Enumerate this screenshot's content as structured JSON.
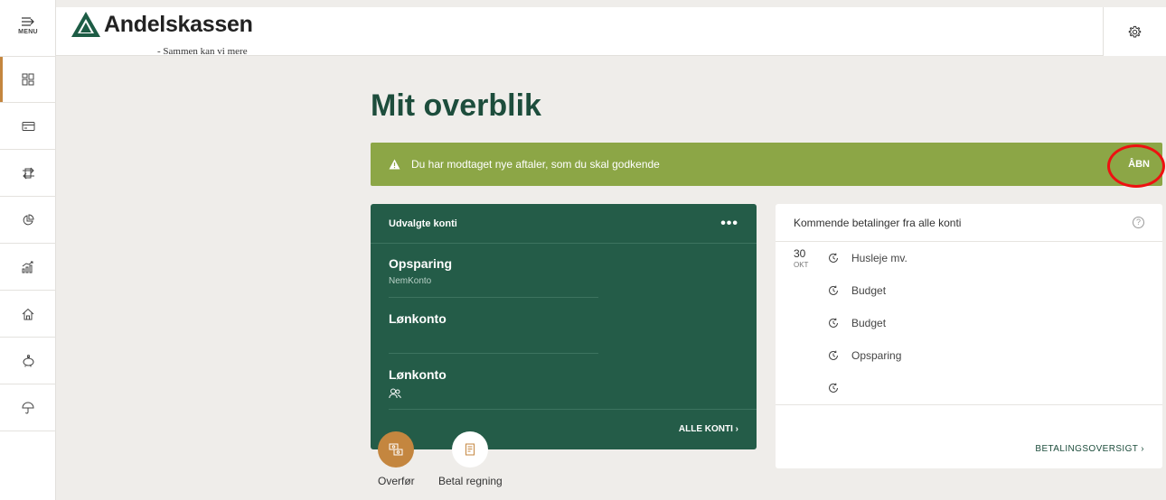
{
  "sidebar": {
    "menu_label": "MENU",
    "items": [
      {
        "icon": "dashboard-icon",
        "active": true
      },
      {
        "icon": "card-icon"
      },
      {
        "icon": "transfer-icon"
      },
      {
        "icon": "pie-chart-icon"
      },
      {
        "icon": "growth-chart-icon"
      },
      {
        "icon": "home-icon"
      },
      {
        "icon": "piggy-bank-icon"
      },
      {
        "icon": "umbrella-icon"
      }
    ]
  },
  "header": {
    "logo_text": "Andelskassen",
    "tagline": "- Sammen kan vi mere",
    "settings_icon": "gear-icon"
  },
  "page": {
    "title": "Mit overblik"
  },
  "alert": {
    "text": "Du har modtaget nye aftaler, som du skal godkende",
    "action_label": "ÅBN"
  },
  "accounts": {
    "title": "Udvalgte konti",
    "more_label": "•••",
    "items": [
      {
        "name": "Opsparing",
        "sub": "NemKonto"
      },
      {
        "name": "Lønkonto",
        "sub": ""
      },
      {
        "name": "Lønkonto",
        "sub": ""
      }
    ],
    "all_label": "ALLE KONTI ›"
  },
  "actions": {
    "transfer_label": "Overfør",
    "pay_bill_label": "Betal regning"
  },
  "payments": {
    "title": "Kommende betalinger fra alle konti",
    "help_label": "?",
    "date": {
      "day": "30",
      "month": "OKT"
    },
    "items": [
      "Husleje mv.",
      "Budget",
      "Budget",
      "Opsparing",
      ""
    ],
    "overview_label": "BETALINGSOVERSIGT ›"
  },
  "colors": {
    "brand_green": "#1d4d3c",
    "card_green": "#245c48",
    "alert_green": "#8ca646",
    "accent_orange": "#c4863f"
  }
}
